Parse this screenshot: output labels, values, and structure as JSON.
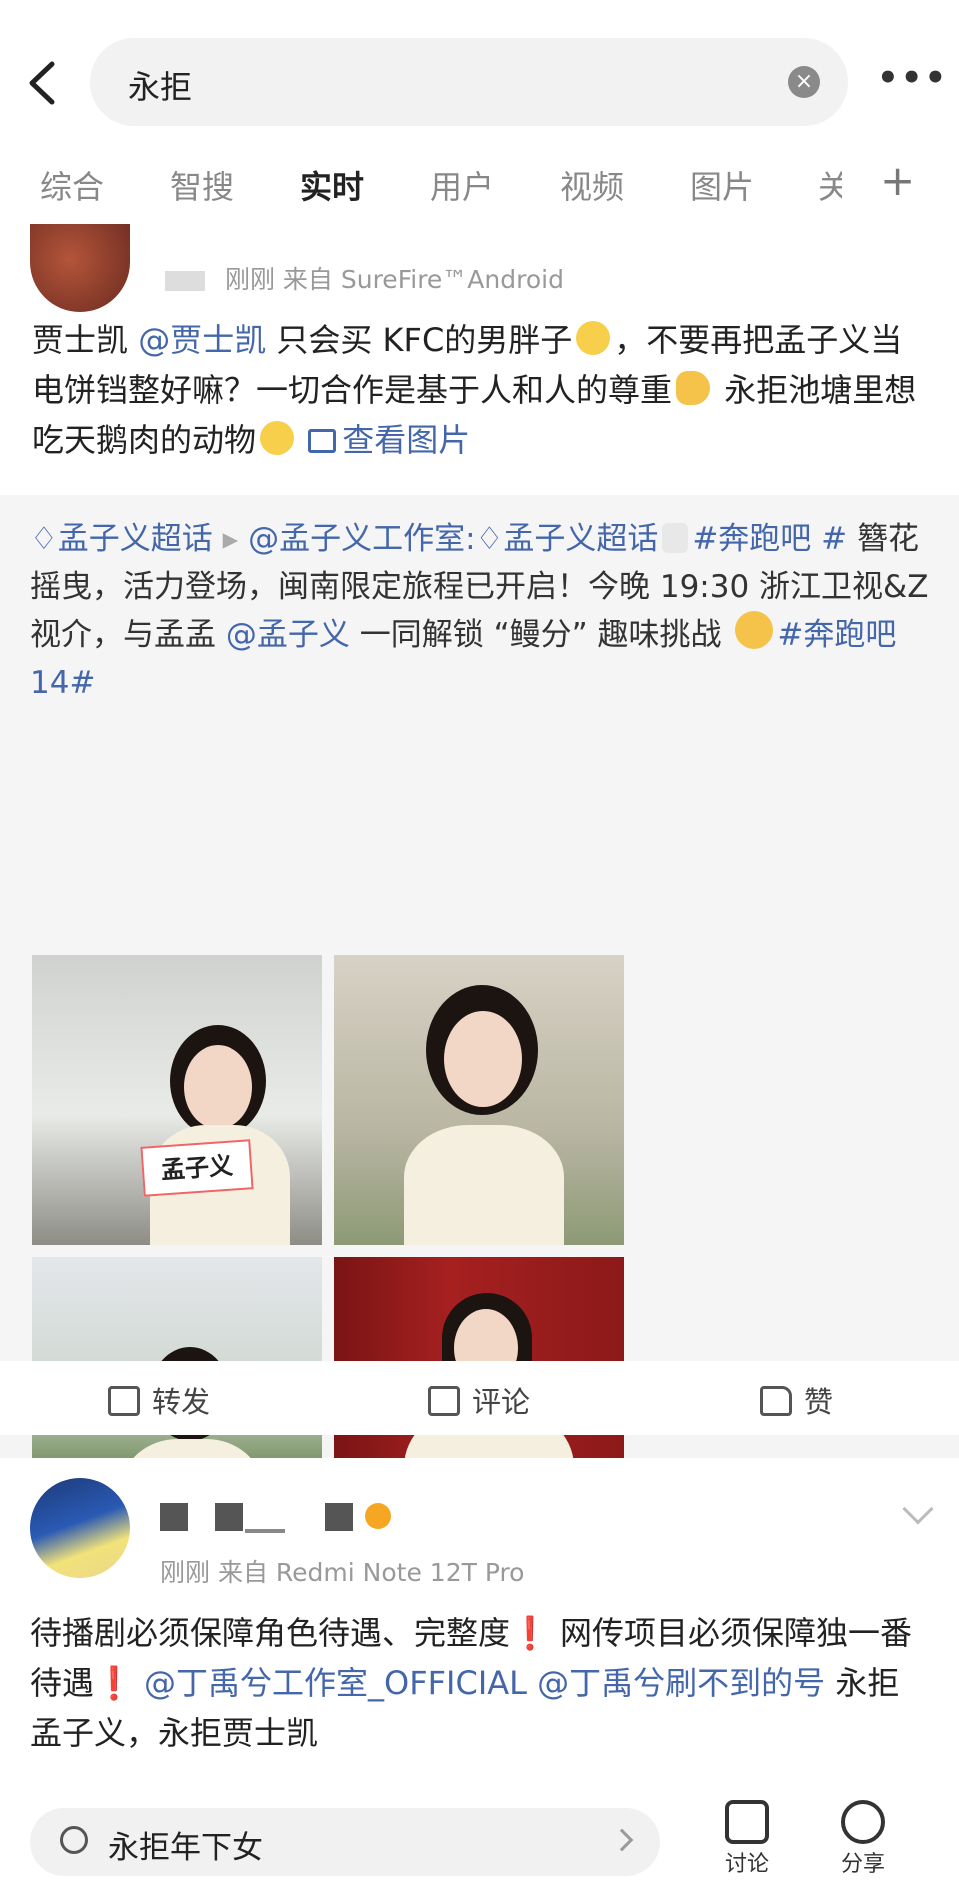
{
  "header": {
    "search_query": "永拒",
    "clear_glyph": "×",
    "more_glyph": "•••",
    "tabs": [
      "综合",
      "智搜",
      "实时",
      "用户",
      "视频",
      "图片",
      "关"
    ],
    "active_tab": "实时",
    "plus_glyph": "+"
  },
  "post1": {
    "meta_time": "刚刚",
    "meta_source": "来自 SureFire™Android",
    "text_part1": "贾士凯",
    "mention1": "@贾士凯",
    "text_part2": " 只会买 KFC的男胖子",
    "text_part3": "，不要再把孟子义当电饼铛整好嘛？一切合作是基于人和人的尊重",
    "text_part4": "永拒池塘里想吃天鹅肉的动物",
    "view_image": "查看图片",
    "repost": {
      "topic1": "孟子义超话",
      "arrow": "▸",
      "author": "@孟子义工作室:",
      "topic2": "孟子义超话",
      "hashtag1": "#奔跑吧 #",
      "body1": " 簪花摇曳，活力登场，闽南限定旅程已开启！今晚 19:30 浙江卫视&Z视介，与孟孟 ",
      "mention": "@孟子义",
      "body2": " 一同解锁 “鳗分” 趣味挑战",
      "hashtag2": "#奔跑吧 14#",
      "image_label": "孟子义"
    },
    "actions": {
      "forward": "转发",
      "comment": "评论",
      "like": "赞"
    }
  },
  "post2": {
    "meta_time": "刚刚",
    "meta_source": "来自 Redmi Note 12T Pro",
    "text1": "待播剧必须保障角色待遇、完整度",
    "mark1": "❗",
    "text2": " 网传项目必须保障独一番待遇",
    "mark2": "❗",
    "mention1": " @丁禹兮工作室_OFFICIAL",
    "mention2": " @丁禹兮刷不到的号",
    "text3": " 永拒孟子义，永拒贾士凯"
  },
  "bottom": {
    "search_text": "永拒年下女",
    "discuss": "讨论",
    "share": "分享"
  },
  "colors": {
    "link": "#4466aa",
    "alert": "#e03030",
    "page_bg": "#f4f4f4"
  }
}
